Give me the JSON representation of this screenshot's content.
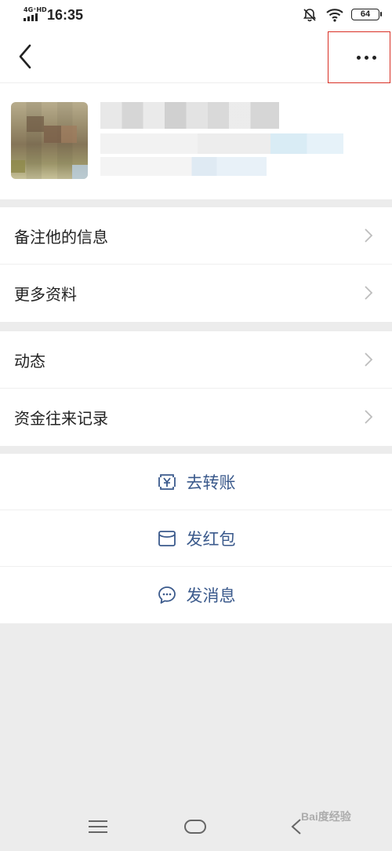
{
  "status_bar": {
    "network": "4G⁺HD",
    "time": "16:35",
    "battery": "64"
  },
  "menu_group_1": [
    {
      "label": "备注他的信息"
    },
    {
      "label": "更多资料"
    }
  ],
  "menu_group_2": [
    {
      "label": "动态"
    },
    {
      "label": "资金往来记录"
    }
  ],
  "actions": [
    {
      "label": "去转账",
      "icon": "yuan-transfer-icon"
    },
    {
      "label": "发红包",
      "icon": "red-packet-icon"
    },
    {
      "label": "发消息",
      "icon": "chat-bubble-icon"
    }
  ],
  "watermark": "Bai度经验",
  "colors": {
    "action_text": "#3b5a8c",
    "highlight_border": "#d93025",
    "page_background": "#ececec"
  }
}
